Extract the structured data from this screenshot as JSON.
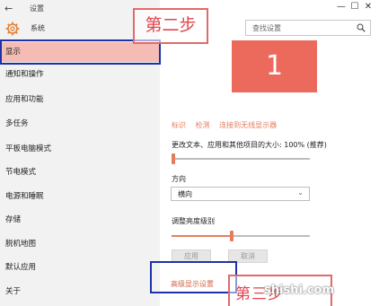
{
  "window": {
    "back_glyph": "←",
    "title": "设置",
    "controls": [
      "—",
      "☐",
      "✕"
    ]
  },
  "sidebar": {
    "section_label": "系统",
    "items": [
      {
        "label": "显示",
        "active": true
      },
      {
        "label": "通知和操作"
      },
      {
        "label": "应用和功能"
      },
      {
        "label": "多任务"
      },
      {
        "label": "平板电脑模式"
      },
      {
        "label": "节电模式"
      },
      {
        "label": "电源和睡眠"
      },
      {
        "label": "存储"
      },
      {
        "label": "脱机地图"
      },
      {
        "label": "默认应用"
      },
      {
        "label": "关于"
      }
    ]
  },
  "annotations": {
    "step2": "第二步",
    "step3": "第三步",
    "watermark": "shishi.com"
  },
  "search": {
    "placeholder": "查找设置",
    "icon": "search-icon"
  },
  "display": {
    "monitor_number": "1",
    "links": [
      "标识",
      "检测",
      "连接到无线显示器"
    ],
    "scale_label": "更改文本、应用和其他项目的大小: 100% (推荐)",
    "scale_value_percent": 0,
    "orientation_label": "方向",
    "orientation_value": "横向",
    "brightness_label": "调整亮度级别",
    "brightness_fraction": 0.42,
    "apply_label": "应用",
    "cancel_label": "取消",
    "advanced_link": "高级显示设置"
  },
  "colors": {
    "accent": "#e57d5c",
    "monitor": "#ec6a5c",
    "active_nav": "#f4bcb4",
    "annotation_blue": "#1d32a8",
    "annotation_red": "#e0464f"
  }
}
